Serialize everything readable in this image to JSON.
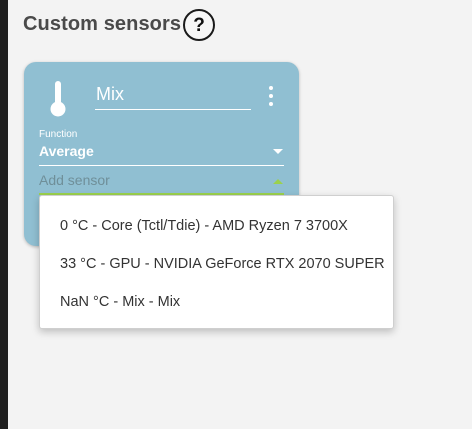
{
  "header": {
    "title": "Custom sensors",
    "help_label": "?"
  },
  "card": {
    "name": "Mix",
    "function_label": "Function",
    "function_value": "Average",
    "add_sensor_placeholder": "Add sensor",
    "background_color": "#90bfd2",
    "accent_color": "#9bd14d",
    "icon": "thermometer-icon"
  },
  "dropdown": {
    "options": [
      "0 °C - Core (Tctl/Tdie) - AMD Ryzen 7 3700X",
      "33 °C - GPU - NVIDIA GeForce RTX 2070 SUPER",
      "NaN °C - Mix - Mix"
    ]
  }
}
